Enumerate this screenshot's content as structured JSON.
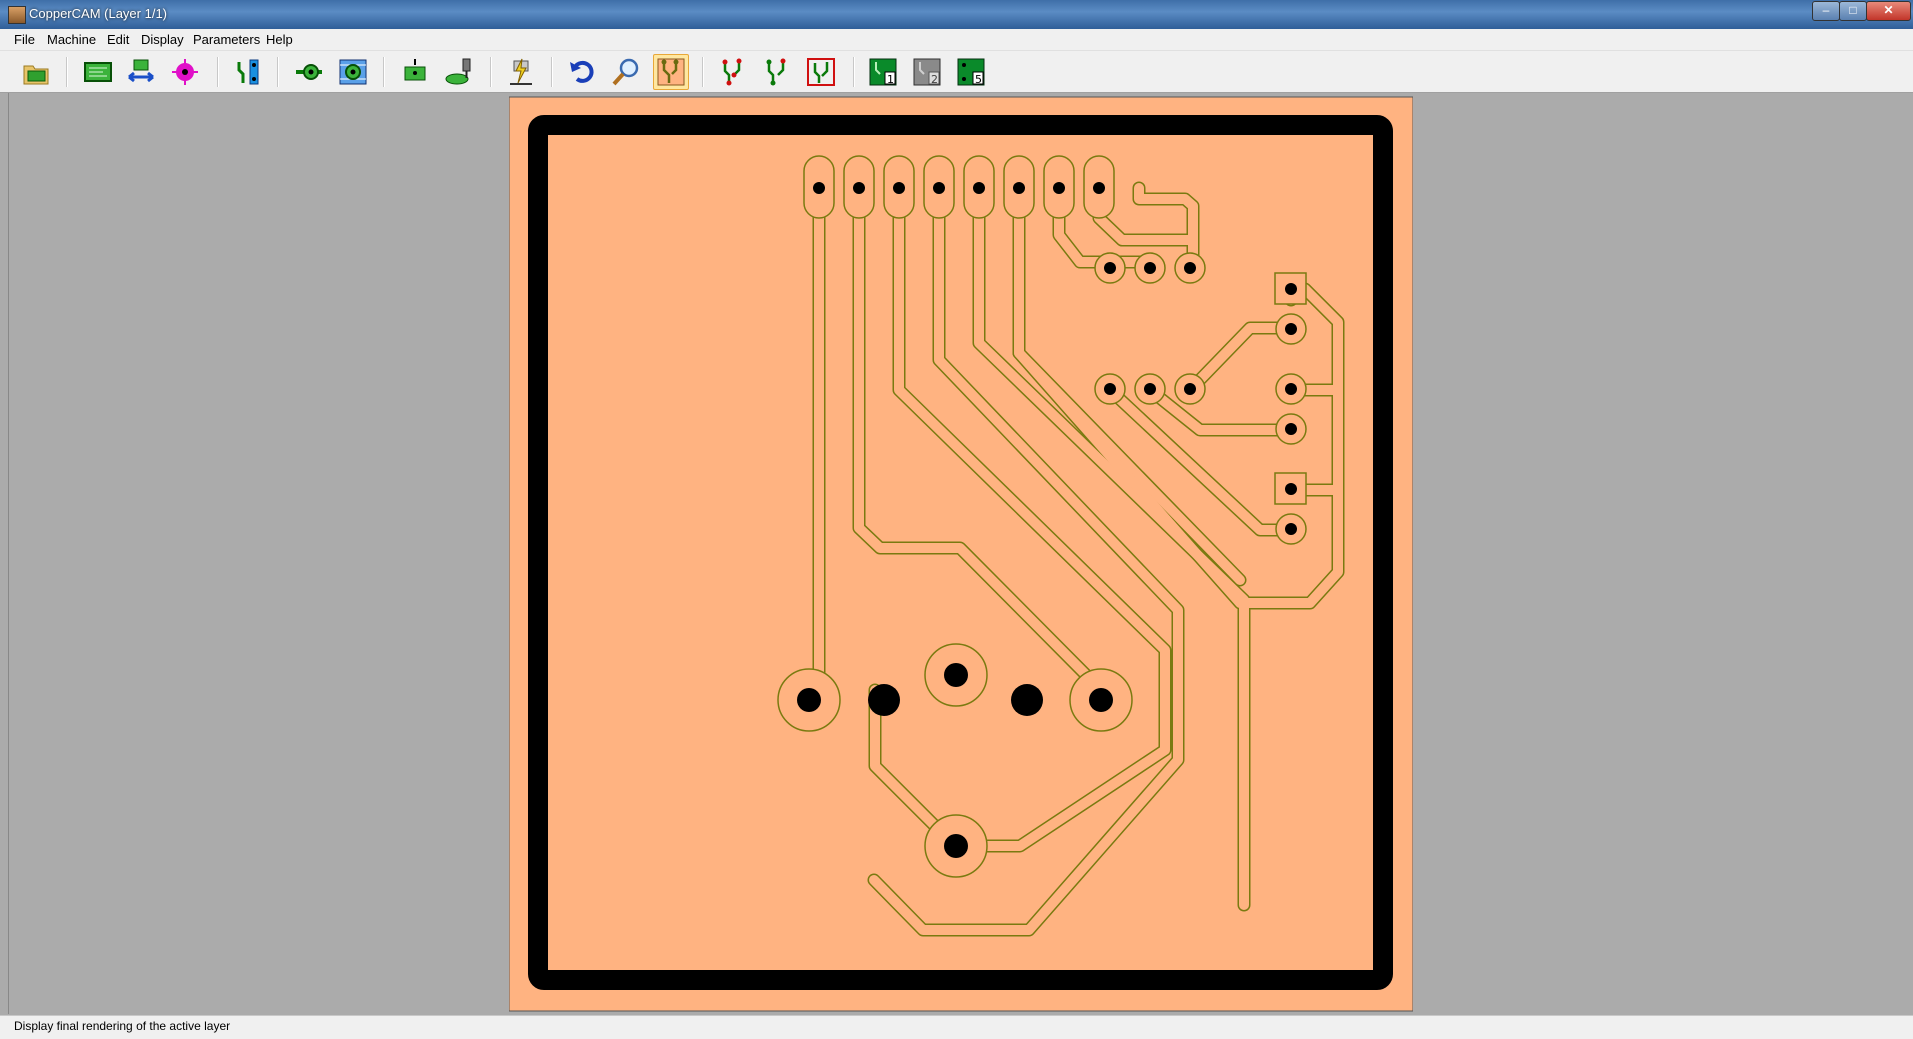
{
  "window": {
    "title": "CopperCAM  (Layer 1/1)"
  },
  "menu": [
    "File",
    "Machine",
    "Edit",
    "Display",
    "Parameters",
    "Help"
  ],
  "toolbar": {
    "layer_labels": [
      "1",
      "2",
      "5"
    ]
  },
  "statusbar": {
    "text": "Display final rendering of the active layer"
  },
  "colors": {
    "board": "#ffb381",
    "board_border": "#000000",
    "trace_outline": "#7a7a10",
    "workspace": "#ababab"
  }
}
